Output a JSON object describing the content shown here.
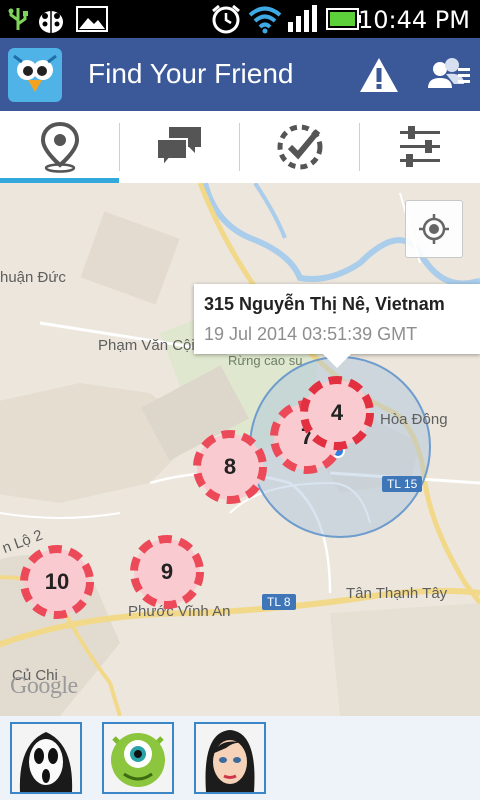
{
  "status_bar": {
    "time": "10:44 PM",
    "icons": [
      "usb-icon",
      "bug-icon",
      "image-icon",
      "alarm-icon",
      "wifi-icon",
      "signal-icon",
      "battery-icon"
    ]
  },
  "action_bar": {
    "title": "Find Your Friend",
    "color": "#3b5998",
    "actions": [
      "warning-icon",
      "friends-icon"
    ]
  },
  "tabs": [
    {
      "icon": "map-pin-icon",
      "selected": true
    },
    {
      "icon": "chat-icon",
      "selected": false
    },
    {
      "icon": "checkin-icon",
      "selected": false
    },
    {
      "icon": "settings-sliders-icon",
      "selected": false
    }
  ],
  "map": {
    "info_window": {
      "address": "315 Nguyễn Thị Nê, Vietnam",
      "timestamp": "19 Jul 2014 03:51:39 GMT"
    },
    "place_labels": {
      "thuan_duc": "huận Đức",
      "pham_van_coi": "Phạm Văn Cội",
      "rung_cao_su": "Rừng cao su",
      "hoa_dong": "Hòa Đông",
      "tan_thanh_tay": "Tân Thạnh Tây",
      "phuoc_vinh_an": "Phước Vĩnh An",
      "cu_chi": "Củ Chi",
      "lo_2": "n Lộ 2"
    },
    "road_badges": {
      "tl15": "TL 15",
      "tl8": "TL 8"
    },
    "markers": [
      {
        "label": "4"
      },
      {
        "label": "7"
      },
      {
        "label": "8"
      },
      {
        "label": "9"
      },
      {
        "label": "10"
      }
    ],
    "attribution": "Google"
  },
  "friends_bar": {
    "avatars": [
      "ghost-mask-avatar",
      "green-monster-avatar",
      "woman-face-avatar"
    ]
  }
}
